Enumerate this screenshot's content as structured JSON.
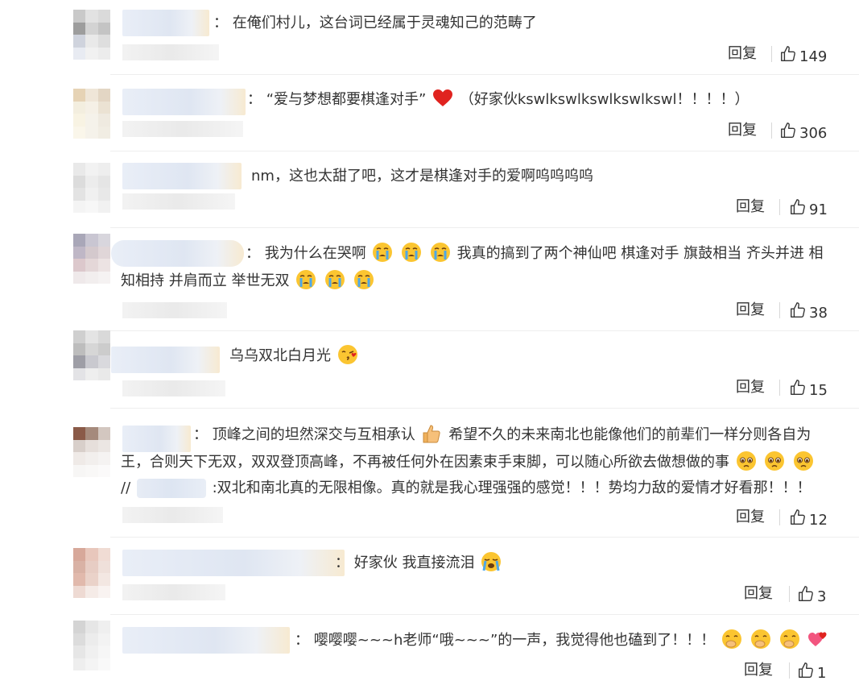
{
  "comments": [
    {
      "id": 1,
      "text": "在俺们村儿，这台词已经属于灵魂知己的范畴了",
      "reply": "回复",
      "likes": "149"
    },
    {
      "id": 2,
      "text_a": "“爱与梦想都要棋逢对手”",
      "text_b": "（好家伙kswlkswlkswlkswlkswl！！！！）",
      "reply": "回复",
      "likes": "306"
    },
    {
      "id": 3,
      "text": "nm，这也太甜了吧，这才是棋逢对手的爱啊呜呜呜呜",
      "reply": "回复",
      "likes": "91"
    },
    {
      "id": 4,
      "text_a": "我为什么在哭啊",
      "text_b": "我真的搞到了两个神仙吧 棋逢对手 旗鼓相当 齐头并进 相",
      "text_c": "知相持 并肩而立 举世无双",
      "reply": "回复",
      "likes": "38"
    },
    {
      "id": 5,
      "text": "乌乌双北白月光",
      "reply": "回复",
      "likes": "15"
    },
    {
      "id": 6,
      "text_a": "顶峰之间的坦然深交与互相承认",
      "text_b": "希望不久的未来南北也能像他们的前辈们一样分则各自为",
      "text_c": "王，合则天下无双，双双登顶高峰，不再被任何外在因素束手束脚，可以随心所欲去做想做的事",
      "text_d": "//",
      "text_e": ":双北和南北真的无限相像。真的就是我心理强强的感觉！！！势均力敌的爱情才好看那！！！",
      "reply": "回复",
      "likes": "12"
    },
    {
      "id": 7,
      "text": "好家伙 我直接流泪",
      "reply": "回复",
      "likes": "3"
    },
    {
      "id": 8,
      "text": "嘤嘤嘤~~~h老师“哦~~~”的一声，我觉得他也磕到了！！！",
      "reply": "回复",
      "likes": "1"
    }
  ],
  "colon": "：",
  "icons": {
    "like": "thumbs-up-icon",
    "heart": "red-heart-emoji",
    "cry": "crying-face-emoji",
    "love": "face-blowing-kiss-emoji",
    "thumb": "thumbs-up-emoji",
    "pleading": "pleading-face-emoji",
    "sob": "loudly-crying-emoji",
    "giggle": "hand-over-mouth-emoji",
    "hearts": "beating-hearts-emoji"
  },
  "colors": {
    "text": "#333333",
    "divider": "#eeeeee",
    "heart": "#e0231f"
  }
}
